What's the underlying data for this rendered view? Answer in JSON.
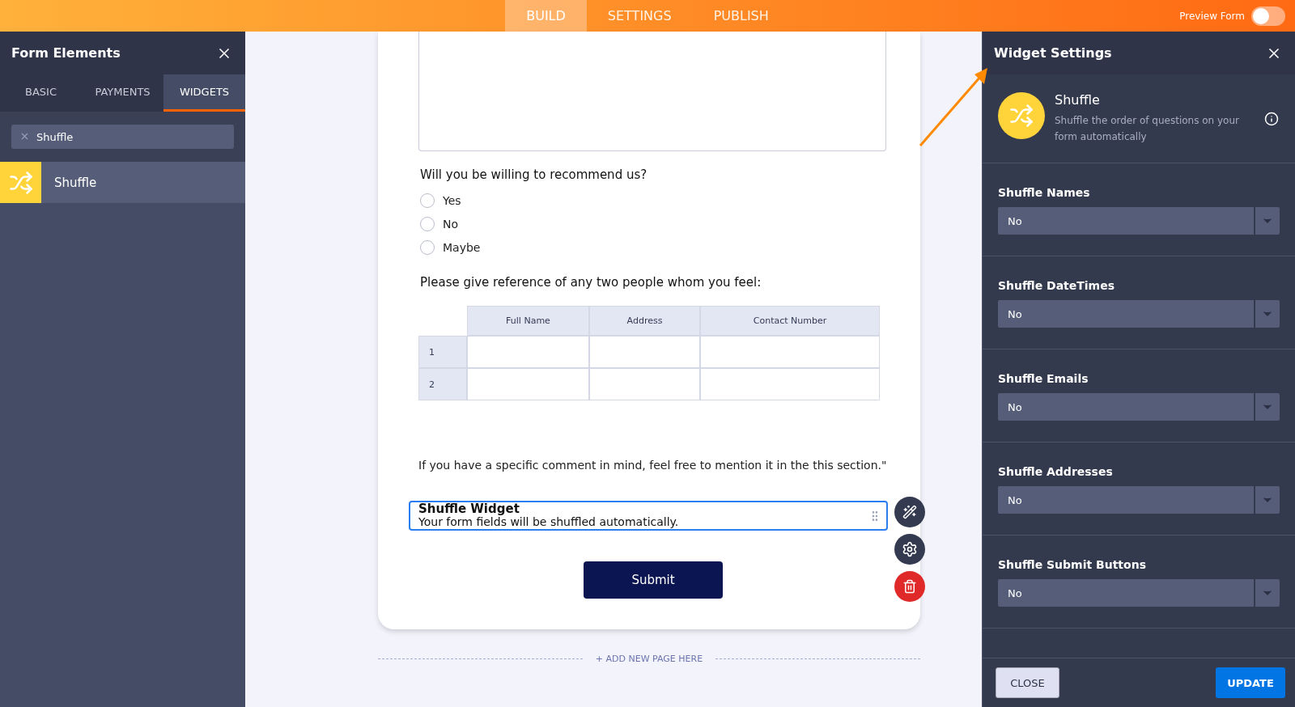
{
  "top_bar": {
    "tabs": [
      {
        "label": "BUILD",
        "selected": true
      },
      {
        "label": "SETTINGS",
        "selected": false
      },
      {
        "label": "PUBLISH",
        "selected": false
      }
    ],
    "preview": {
      "label": "Preview Form",
      "on": false
    }
  },
  "left_panel": {
    "title": "Form Elements",
    "tabs": [
      {
        "label": "BASIC",
        "selected": false
      },
      {
        "label": "PAYMENTS",
        "selected": false
      },
      {
        "label": "WIDGETS",
        "selected": true
      }
    ],
    "search": {
      "value": "Shuffle"
    },
    "results": [
      {
        "label": "Shuffle"
      }
    ]
  },
  "form": {
    "question": "Will you be willing to recommend us?",
    "options": [
      {
        "label": "Yes",
        "selected": false
      },
      {
        "label": "No",
        "selected": false
      },
      {
        "label": "Maybe",
        "selected": false
      }
    ],
    "table_question": "Please give reference of any two people whom you feel:",
    "table": {
      "columns": [
        "Full Name",
        "Address",
        "Contact Number"
      ],
      "rows": [
        "1",
        "2"
      ]
    },
    "comment": "If you have a specific comment in mind, feel free to mention it in the this section.\"",
    "widget": {
      "title": "Shuffle Widget",
      "description": "Your form fields will be shuffled automatically."
    },
    "submit": "Submit",
    "add_page": "+ ADD NEW PAGE HERE"
  },
  "right_panel": {
    "title": "Widget Settings",
    "widget": {
      "name": "Shuffle",
      "description": "Shuffle the order of questions on your form automatically"
    },
    "settings": [
      {
        "label": "Shuffle Names",
        "value": "No"
      },
      {
        "label": "Shuffle DateTimes",
        "value": "No"
      },
      {
        "label": "Shuffle Emails",
        "value": "No"
      },
      {
        "label": "Shuffle Addresses",
        "value": "No"
      },
      {
        "label": "Shuffle Submit Buttons",
        "value": "No"
      }
    ],
    "close": "CLOSE",
    "update": "UPDATE"
  }
}
